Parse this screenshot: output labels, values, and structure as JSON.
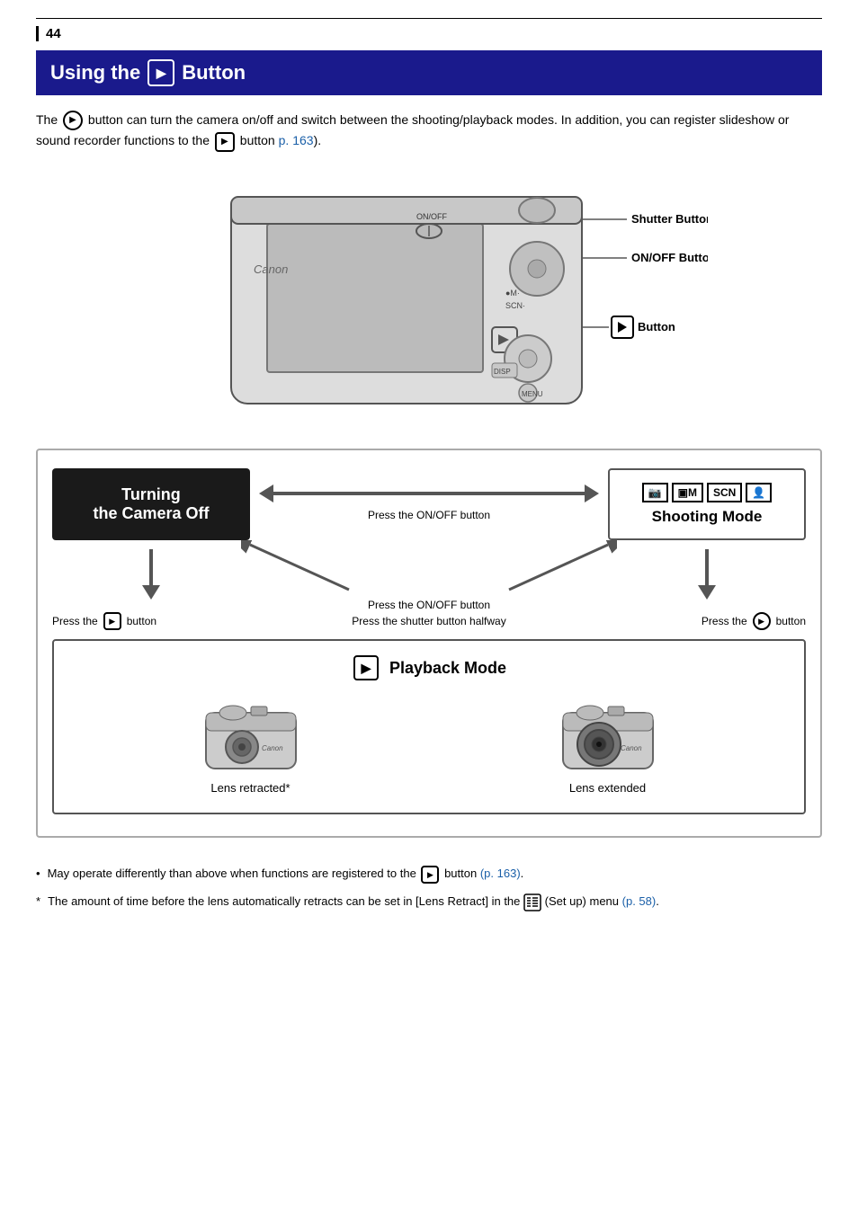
{
  "page": {
    "number": "44",
    "title": "Using the",
    "title_icon": "▶",
    "title_suffix": "Button",
    "intro": "button can turn the camera on/off and switch between the shooting/playback modes. In addition, you can register slideshow or sound recorder functions to the",
    "intro_link": "p. 163",
    "intro_suffix": "button",
    "shutter_button_label": "Shutter Button",
    "onoff_button_label": "ON/OFF Button",
    "play_button_label": "▶  Button",
    "turning_off_title": "Turning\nthe Camera Off",
    "shooting_mode_title": "Shooting Mode",
    "playback_mode_title": "Playback Mode",
    "press_onoff_top": "Press the\nON/OFF button",
    "press_onoff_bottom": "Press the\nON/OFF button",
    "press_shutter": "Press the shutter\nbutton halfway",
    "press_play_left": "button",
    "press_play_right": "button",
    "press_the": "Press the",
    "lens_retracted": "Lens retracted*",
    "lens_extended": "Lens extended",
    "note1_text": "May operate differently than above when functions are registered to the",
    "note1_link": "(p. 163)",
    "note1_suffix": "button",
    "note2_text": "The amount of time before the lens automatically retracts can be set in [Lens Retract] in the",
    "note2_suffix": "(Set up) menu",
    "note2_link": "(p. 58)"
  }
}
